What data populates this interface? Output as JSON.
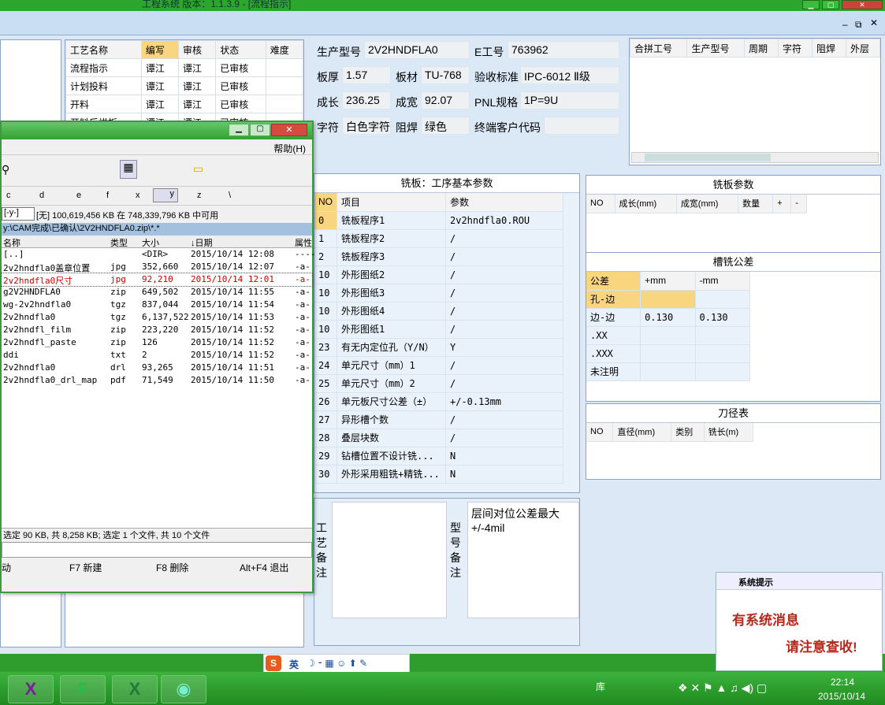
{
  "window": {
    "title": "工程系统  版本：1.1.3.9 - [流程指示]"
  },
  "process_table": {
    "columns": [
      "工艺名称",
      "编写",
      "审核",
      "状态",
      "难度"
    ],
    "rows": [
      [
        "流程指示",
        "谭江",
        "谭江",
        "已审核",
        ""
      ],
      [
        "计划投料",
        "谭江",
        "谭江",
        "已审核",
        ""
      ],
      [
        "开料",
        "谭江",
        "谭江",
        "已审核",
        ""
      ],
      [
        "开料后烘板",
        "谭江",
        "谭江",
        "已审核",
        ""
      ]
    ]
  },
  "info": {
    "model_label": "生产型号",
    "model": "2V2HNDFLA0",
    "eno_label": "E工号",
    "eno": "763962",
    "thick_label": "板厚",
    "thick": "1.57",
    "material_label": "板材",
    "material": "TU-768",
    "std_label": "验收标准",
    "std": "IPC-6012 Ⅱ级",
    "len_label": "成长",
    "len": "236.25",
    "wid_label": "成宽",
    "wid": "92.07",
    "pnl_label": "PNL规格",
    "pnl": "1P=9U",
    "char_label": "字符",
    "char": "白色字符",
    "mask_label": "阻焊",
    "mask": "绿色",
    "cust_label": "终端客户代码",
    "cust": ""
  },
  "merge_table": {
    "columns": [
      "合拼工号",
      "生产型号",
      "周期",
      "字符",
      "阻焊",
      "外层"
    ]
  },
  "mill": {
    "title": "铣板：工序基本参数",
    "columns": [
      "NO",
      "项目",
      "参数"
    ],
    "rows": [
      [
        "0",
        "铣板程序1",
        "2v2hndfla0.ROU"
      ],
      [
        "1",
        "铣板程序2",
        "/"
      ],
      [
        "2",
        "铣板程序3",
        "/"
      ],
      [
        "10",
        "外形图纸2",
        "/"
      ],
      [
        "10",
        "外形图纸3",
        "/"
      ],
      [
        "10",
        "外形图纸4",
        "/"
      ],
      [
        "10",
        "外形图纸1",
        "/"
      ],
      [
        "23",
        "有无内定位孔（Y/N）",
        "Y"
      ],
      [
        "24",
        "单元尺寸（mm）1",
        "/"
      ],
      [
        "25",
        "单元尺寸（mm）2",
        "/"
      ],
      [
        "26",
        "单元板尺寸公差（±）",
        "+/-0.13mm"
      ],
      [
        "27",
        "异形槽个数",
        "/"
      ],
      [
        "28",
        "叠层块数",
        "/"
      ],
      [
        "29",
        "钻槽位置不设计铣...",
        "N"
      ],
      [
        "30",
        "外形采用粗铣+精铣...",
        "N"
      ]
    ]
  },
  "board_params": {
    "title": "铣板参数",
    "columns": [
      "NO",
      "成长(mm)",
      "成宽(mm)",
      "数量",
      "+",
      "-"
    ]
  },
  "slot_tol": {
    "title": "槽铣公差",
    "columns": [
      "公差",
      "+mm",
      "-mm"
    ],
    "rows": [
      [
        "孔-边",
        "",
        ""
      ],
      [
        "边-边",
        "0.130",
        "0.130"
      ],
      [
        ".XX",
        "",
        ""
      ],
      [
        ".XXX",
        "",
        ""
      ],
      [
        "未注明",
        "",
        ""
      ]
    ]
  },
  "tools": {
    "title": "刀径表",
    "columns": [
      "NO",
      "直径(mm)",
      "类别",
      "铣长(m)"
    ]
  },
  "remarks": {
    "process_label": "工艺备注",
    "model_label": "型号备注",
    "model_text": "层间对位公差最大\n+/-4mil"
  },
  "fm": {
    "menu_help": "帮助(H)",
    "drives": [
      "c",
      "d",
      "e",
      "f",
      "x",
      "y",
      "z",
      "\\"
    ],
    "drive_sel": "[-y-]",
    "free": "[无] 100,619,456 KB 在 748,339,796 KB 中可用",
    "path": "y:\\CAM完成\\已确认\\2V2HNDFLA0.zip\\*.*",
    "columns": [
      "名称",
      "类型",
      "大小",
      "↓日期",
      "属性"
    ],
    "files": [
      {
        "name": "[..]",
        "type": "",
        "size": "<DIR>",
        "date": "2015/10/14 12:08",
        "attr": "----"
      },
      {
        "name": "2v2hndfla0盖章位置",
        "type": "jpg",
        "size": "352,660",
        "date": "2015/10/14 12:07",
        "attr": "-a-"
      },
      {
        "name": "2v2hndfla0尺寸",
        "type": "jpg",
        "size": "92,210",
        "date": "2015/10/14 12:01",
        "attr": "-a-"
      },
      {
        "name": "g2V2HNDFLA0",
        "type": "zip",
        "size": "649,502",
        "date": "2015/10/14 11:55",
        "attr": "-a-"
      },
      {
        "name": "wg-2v2hndfla0",
        "type": "tgz",
        "size": "837,044",
        "date": "2015/10/14 11:54",
        "attr": "-a-"
      },
      {
        "name": "2v2hndfla0",
        "type": "tgz",
        "size": "6,137,522",
        "date": "2015/10/14 11:53",
        "attr": "-a-"
      },
      {
        "name": "2v2hndfl_film",
        "type": "zip",
        "size": "223,220",
        "date": "2015/10/14 11:52",
        "attr": "-a-"
      },
      {
        "name": "2v2hndfl_paste",
        "type": "zip",
        "size": "126",
        "date": "2015/10/14 11:52",
        "attr": "-a-"
      },
      {
        "name": "ddi",
        "type": "txt",
        "size": "2",
        "date": "2015/10/14 11:52",
        "attr": "-a-"
      },
      {
        "name": "2v2hndfla0",
        "type": "drl",
        "size": "93,265",
        "date": "2015/10/14 11:51",
        "attr": "-a-"
      },
      {
        "name": "2v2hndfla0_drl_map",
        "type": "pdf",
        "size": "71,549",
        "date": "2015/10/14 11:50",
        "attr": "-a-"
      }
    ],
    "status": "选定 90 KB, 共 8,258 KB; 选定 1 个文件, 共 10 个文件",
    "keys": [
      "动",
      "F7 新建",
      "F8 删除",
      "Alt+F4 退出"
    ]
  },
  "notify": {
    "title": "系统提示",
    "line1": "有系统消息",
    "line2": "请注意查收!"
  },
  "taskbar": {
    "lib": "库",
    "time": "22:14",
    "date": "2015/10/14"
  },
  "ime": {
    "label": "英"
  }
}
